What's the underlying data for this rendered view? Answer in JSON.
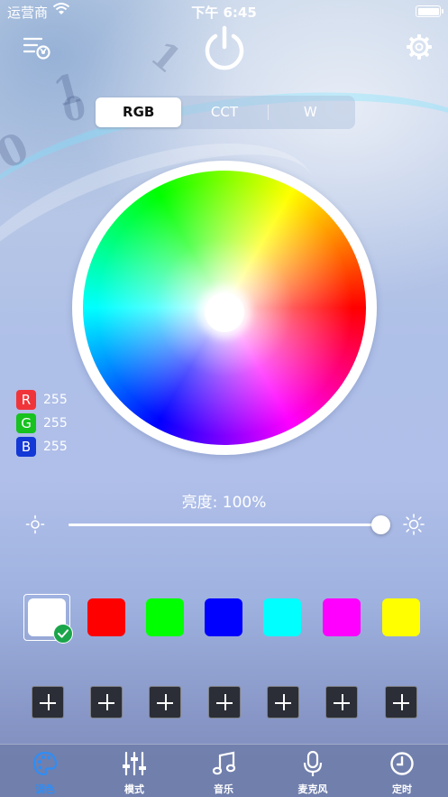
{
  "status_bar": {
    "carrier": "运营商",
    "time": "下午 6:45"
  },
  "mode_tabs": [
    {
      "label": "RGB",
      "active": true
    },
    {
      "label": "CCT",
      "active": false
    },
    {
      "label": "W",
      "active": false
    }
  ],
  "rgb_readout": [
    {
      "channel": "R",
      "value": "255",
      "color": "#f0353a"
    },
    {
      "channel": "G",
      "value": "255",
      "color": "#18c21f"
    },
    {
      "channel": "B",
      "value": "255",
      "color": "#1438d6"
    }
  ],
  "brightness": {
    "label": "亮度: 100%",
    "level": 1.0
  },
  "swatches": [
    {
      "color": "#ffffff",
      "selected": true
    },
    {
      "color": "#ff0000",
      "selected": false
    },
    {
      "color": "#00ff00",
      "selected": false
    },
    {
      "color": "#0000ff",
      "selected": false
    },
    {
      "color": "#00ffff",
      "selected": false
    },
    {
      "color": "#ff00ff",
      "selected": false
    },
    {
      "color": "#ffff00",
      "selected": false
    }
  ],
  "custom_slots_count": 7,
  "tab_bar": [
    {
      "label": "调色",
      "icon": "palette-icon",
      "active": true
    },
    {
      "label": "模式",
      "icon": "sliders-icon",
      "active": false
    },
    {
      "label": "音乐",
      "icon": "music-note-icon",
      "active": false
    },
    {
      "label": "麦克风",
      "icon": "microphone-icon",
      "active": false
    },
    {
      "label": "定时",
      "icon": "clock-icon",
      "active": false
    }
  ],
  "accent_color": "#2f8df5"
}
